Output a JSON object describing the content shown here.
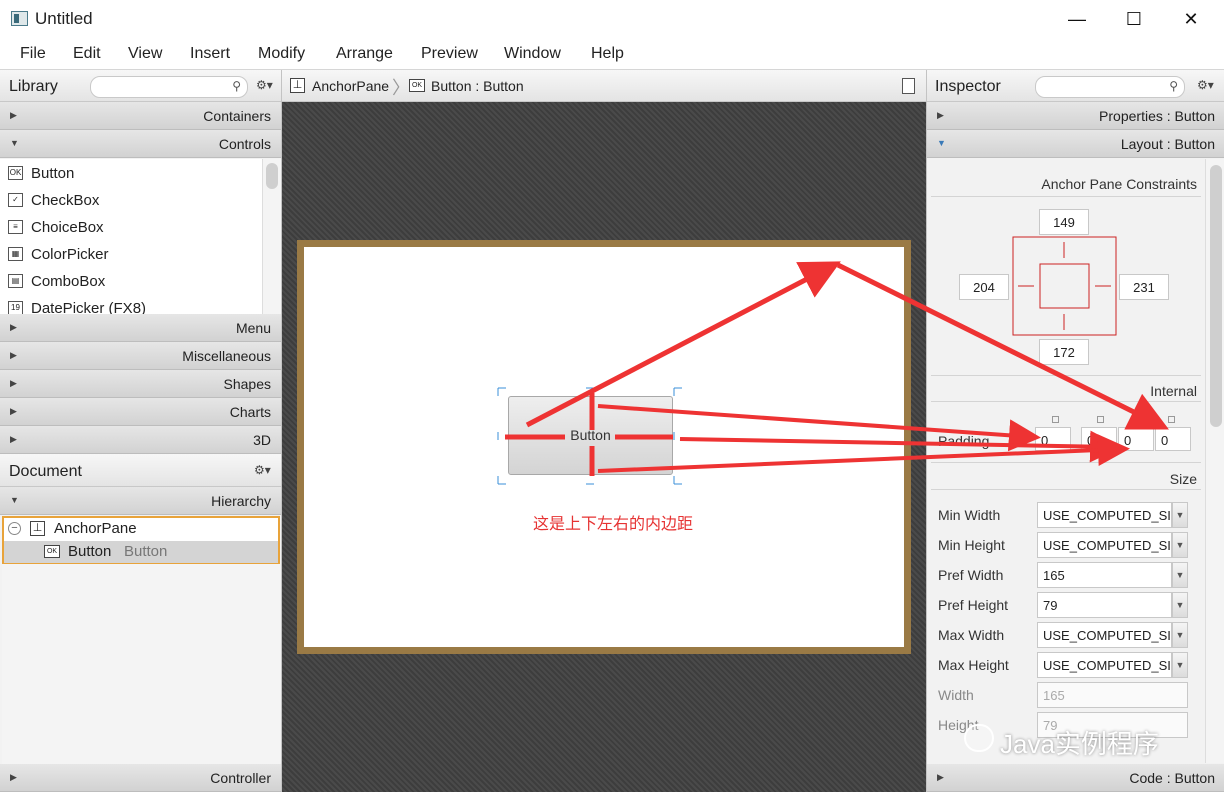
{
  "window": {
    "title": "Untitled",
    "minimize": "—",
    "maximize": "☐",
    "close": "✕"
  },
  "menu": [
    "File",
    "Edit",
    "View",
    "Insert",
    "Modify",
    "Arrange",
    "Preview",
    "Window",
    "Help"
  ],
  "library": {
    "title": "Library",
    "sections_top": [
      {
        "label": "Containers",
        "expanded": false
      },
      {
        "label": "Controls",
        "expanded": true
      }
    ],
    "items": [
      {
        "label": "Button",
        "icon": "OK"
      },
      {
        "label": "CheckBox",
        "icon": "✓"
      },
      {
        "label": "ChoiceBox",
        "icon": "≡"
      },
      {
        "label": "ColorPicker",
        "icon": "▦"
      },
      {
        "label": "ComboBox",
        "icon": "▤"
      },
      {
        "label": "DatePicker  (FX8)",
        "icon": "19"
      }
    ],
    "sections_bottom": [
      "Menu",
      "Miscellaneous",
      "Shapes",
      "Charts",
      "3D"
    ]
  },
  "document": {
    "title": "Document",
    "hierarchy_label": "Hierarchy",
    "tree": [
      {
        "label": "AnchorPane",
        "sub": ""
      },
      {
        "label": "Button",
        "sub": "Button"
      }
    ],
    "controller_label": "Controller"
  },
  "breadcrumb": [
    "AnchorPane",
    "Button : Button"
  ],
  "design": {
    "button_label": "Button",
    "annotation": "这是上下左右的内边距"
  },
  "inspector": {
    "title": "Inspector",
    "properties": "Properties : Button",
    "layout": "Layout : Button",
    "anchor_heading": "Anchor Pane Constraints",
    "anchor": {
      "top": "149",
      "left": "204",
      "right": "231",
      "bottom": "172"
    },
    "internal_heading": "Internal",
    "padding_label": "Padding",
    "padding": [
      "0",
      "0",
      "0",
      "0"
    ],
    "size_heading": "Size",
    "size_rows": [
      {
        "label": "Min Width",
        "value": "USE_COMPUTED_SIZE",
        "dropdown": true,
        "disabled": false
      },
      {
        "label": "Min Height",
        "value": "USE_COMPUTED_SIZE",
        "dropdown": true,
        "disabled": false
      },
      {
        "label": "Pref Width",
        "value": "165",
        "dropdown": true,
        "disabled": false
      },
      {
        "label": "Pref Height",
        "value": "79",
        "dropdown": true,
        "disabled": false
      },
      {
        "label": "Max Width",
        "value": "USE_COMPUTED_SIZE",
        "dropdown": true,
        "disabled": false
      },
      {
        "label": "Max Height",
        "value": "USE_COMPUTED_SIZE",
        "dropdown": true,
        "disabled": false
      },
      {
        "label": "Width",
        "value": "165",
        "dropdown": false,
        "disabled": true
      },
      {
        "label": "Height",
        "value": "79",
        "dropdown": false,
        "disabled": true
      }
    ],
    "code": "Code : Button"
  },
  "watermark": "Java实例程序"
}
